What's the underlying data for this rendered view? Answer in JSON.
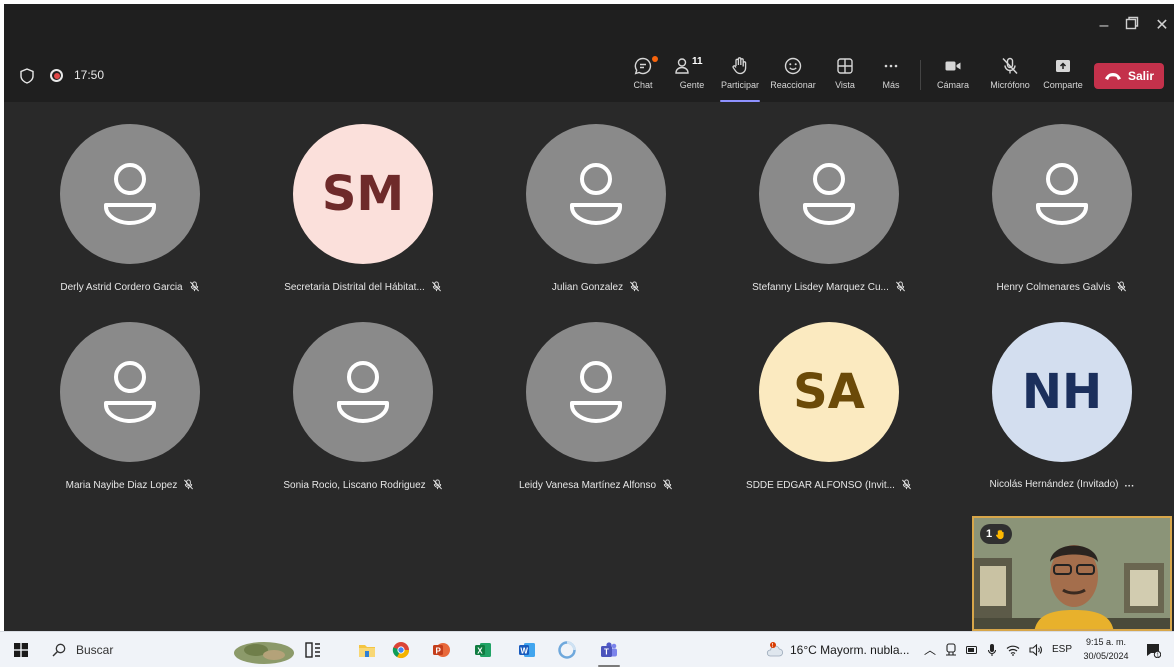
{
  "toolbar": {
    "timer": "17:50",
    "buttons": {
      "chat": "Chat",
      "gente": "Gente",
      "gente_count": "11",
      "participar": "Participar",
      "reaccionar": "Reaccionar",
      "vista": "Vista",
      "mas": "Más",
      "camara": "Cámara",
      "microfono": "Micrófono",
      "comparte": "Comparte"
    },
    "leave_label": "Salir"
  },
  "participants": [
    {
      "name": "Derly Astrid Cordero Garcia",
      "initials": "",
      "avatar_color": "#8a8a8a"
    },
    {
      "name": "Secretaria Distrital del Hábitat...",
      "initials": "SM",
      "avatar_color": "#fbe0db",
      "initials_color": "#6e2a2a"
    },
    {
      "name": "Julian Gonzalez",
      "initials": "",
      "avatar_color": "#8a8a8a"
    },
    {
      "name": "Stefanny Lisdey Marquez Cu...",
      "initials": "",
      "avatar_color": "#8a8a8a"
    },
    {
      "name": "Henry Colmenares Galvis",
      "initials": "",
      "avatar_color": "#8a8a8a"
    },
    {
      "name": "Maria Nayibe Diaz Lopez",
      "initials": "",
      "avatar_color": "#8a8a8a"
    },
    {
      "name": "Sonia Rocio, Liscano Rodriguez",
      "initials": "",
      "avatar_color": "#8a8a8a"
    },
    {
      "name": "Leidy Vanesa Martínez Alfonso",
      "initials": "",
      "avatar_color": "#8a8a8a"
    },
    {
      "name": "SDDE EDGAR ALFONSO (Invit...",
      "initials": "SA",
      "avatar_color": "#fbeac0",
      "initials_color": "#6b4a08"
    },
    {
      "name": "Nicolás Hernández (Invitado)",
      "initials": "NH",
      "avatar_color": "#d3deef",
      "initials_color": "#1b2f5c"
    }
  ],
  "selfview": {
    "raise_count": "1"
  },
  "taskbar": {
    "search_placeholder": "Buscar",
    "weather": "16°C  Mayorm. nubla...",
    "language": "ESP",
    "time": "9:15 a. m.",
    "date": "30/05/2024"
  }
}
